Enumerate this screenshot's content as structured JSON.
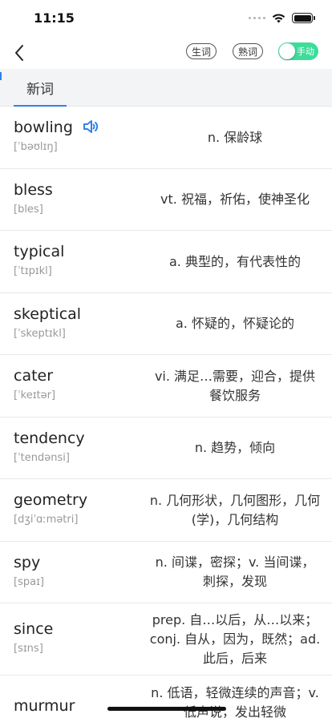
{
  "status_bar": {
    "time": "11:15"
  },
  "nav": {
    "new_words_chip": "生词",
    "known_words_chip": "熟词",
    "mode_toggle_label": "手动"
  },
  "tabs": [
    {
      "label": "新词",
      "active": true
    }
  ],
  "words": [
    {
      "word": "bowling",
      "phonetic": "[ˈbəʊlɪŋ]",
      "meaning": "n. 保龄球",
      "has_audio": true
    },
    {
      "word": "bless",
      "phonetic": "[bles]",
      "meaning": "vt. 祝福，祈佑，使神圣化"
    },
    {
      "word": "typical",
      "phonetic": "[ˈtɪpɪkl]",
      "meaning": "a. 典型的，有代表性的"
    },
    {
      "word": "skeptical",
      "phonetic": "[ˈskeptɪkl]",
      "meaning": "a. 怀疑的，怀疑论的"
    },
    {
      "word": "cater",
      "phonetic": "[ˈkeɪtər]",
      "meaning": "vi. 满足…需要，迎合，提供餐饮服务"
    },
    {
      "word": "tendency",
      "phonetic": "[ˈtendənsi]",
      "meaning": "n. 趋势，倾向"
    },
    {
      "word": "geometry",
      "phonetic": "[dʒiˈɑːmətri]",
      "meaning": "n. 几何形状，几何图形，几何(学)，几何结构"
    },
    {
      "word": "spy",
      "phonetic": "[spaɪ]",
      "meaning": "n. 间谍，密探；v. 当间谍，刺探，发现"
    },
    {
      "word": "since",
      "phonetic": "[sɪns]",
      "meaning": "prep. 自…以后，从…以来；conj. 自从，因为，既然；ad. 此后，后来"
    },
    {
      "word": "murmur",
      "phonetic": "",
      "meaning": "n. 低语，轻微连续的声音；v. 低声说，发出轻微"
    }
  ],
  "colors": {
    "accent": "#2f80ed",
    "toggle": "#3ddc9b"
  }
}
